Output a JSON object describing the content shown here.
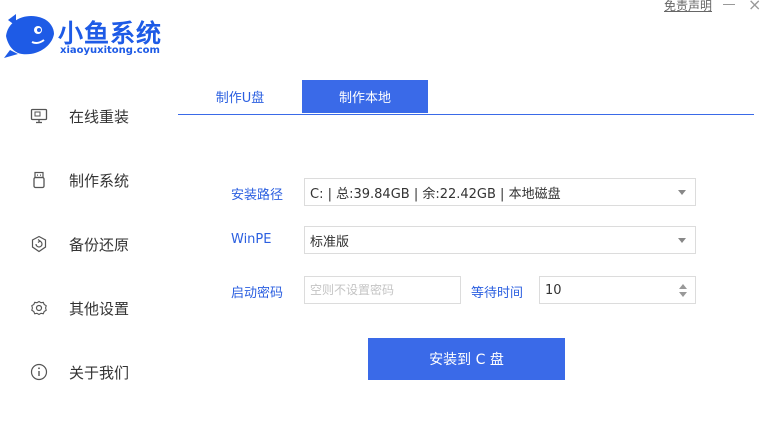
{
  "app": {
    "title": "小鱼系统",
    "subtitle": "xiaoyuxitong.com",
    "disclaimer": "免责声明",
    "close_symbol": "×",
    "brand_color": "#1e5be6"
  },
  "sidebar": {
    "items": [
      {
        "label": "在线重装",
        "icon": "monitor-icon"
      },
      {
        "label": "制作系统",
        "icon": "usb-drive-icon"
      },
      {
        "label": "备份还原",
        "icon": "backup-restore-icon"
      },
      {
        "label": "其他设置",
        "icon": "gear-icon"
      },
      {
        "label": "关于我们",
        "icon": "info-icon"
      }
    ]
  },
  "tabs": [
    {
      "label": "制作U盘",
      "active": false
    },
    {
      "label": "制作本地",
      "active": true
    }
  ],
  "form": {
    "install_path": {
      "label": "安装路径",
      "value": "C: | 总:39.84GB | 余:22.42GB | 本地磁盘"
    },
    "winpe": {
      "label": "WinPE",
      "value": "标准版"
    },
    "boot_password": {
      "label": "启动密码",
      "placeholder": "空则不设置密码"
    },
    "wait_time": {
      "label": "等待时间",
      "value": "10"
    }
  },
  "install_button": {
    "label": "安装到 C 盘"
  },
  "accent_color": "#3a6ae8"
}
